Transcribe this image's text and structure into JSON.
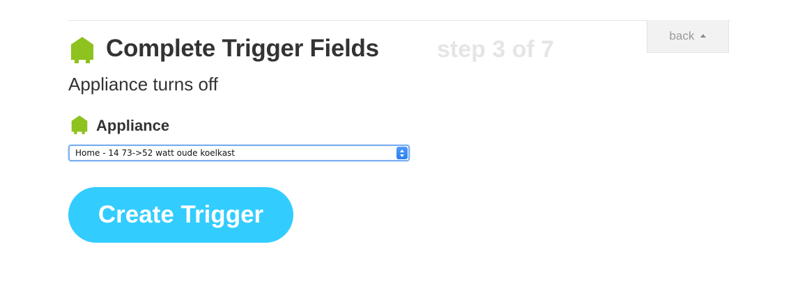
{
  "header": {
    "title": "Complete Trigger Fields",
    "step": "step 3 of 7",
    "back_label": "back",
    "channel_icon": "house-icon"
  },
  "trigger": {
    "name": "Appliance turns off"
  },
  "fields": {
    "appliance": {
      "label": "Appliance",
      "icon": "house-icon",
      "selected_value": "Home - 14 73->52 watt oude koelkast"
    }
  },
  "actions": {
    "create_label": "Create Trigger"
  },
  "colors": {
    "channel_green": "#8ec21f",
    "button_blue": "#33ccff",
    "step_gray": "#e5e5e5",
    "title_dark": "#333333"
  }
}
